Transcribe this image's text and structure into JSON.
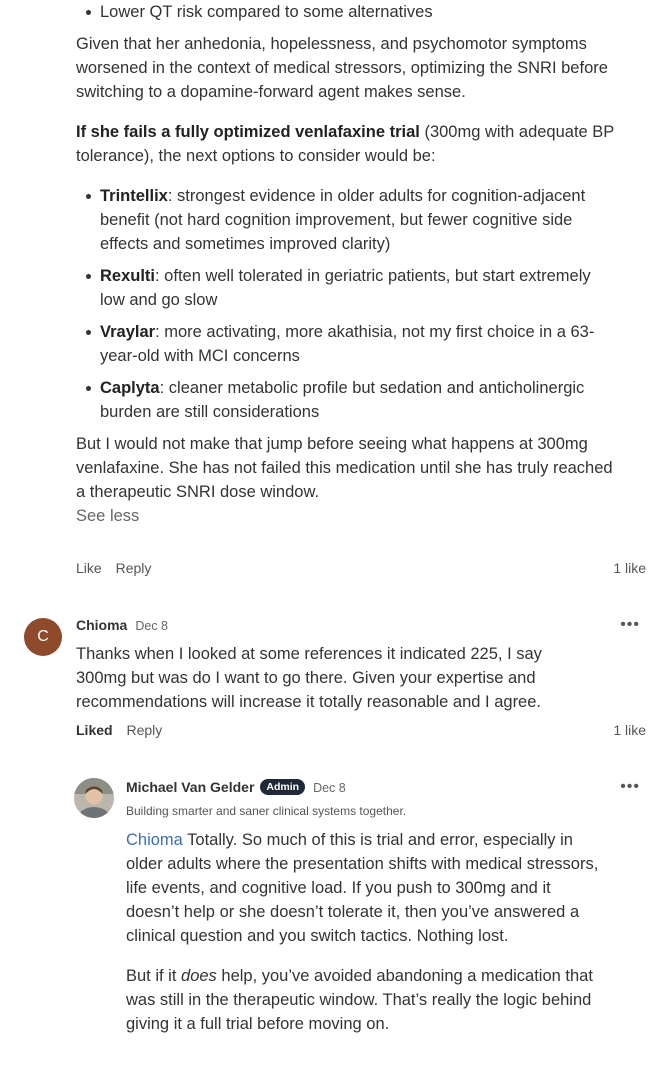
{
  "post": {
    "top_bullet": "Lower QT risk compared to some alternatives",
    "para1": "Given that her anhedonia, hopelessness, and psychomotor symptoms worsened in the context of medical stressors, optimizing the SNRI before switching to a dopamine-forward agent makes sense.",
    "para2_bold": "If she fails a fully optimized venlafaxine trial",
    "para2_rest": " (300mg with adequate BP tolerance), the next options to consider would be:",
    "options": [
      {
        "name": "Trintellix",
        "text": ": strongest evidence in older adults for cognition-adjacent benefit (not hard cognition improvement, but fewer cognitive side effects and sometimes improved clarity)"
      },
      {
        "name": "Rexulti",
        "text": ": often well tolerated in geriatric patients, but start extremely low and go slow"
      },
      {
        "name": "Vraylar",
        "text": ": more activating, more akathisia, not my first choice in a 63-year-old with MCI concerns"
      },
      {
        "name": "Caplyta",
        "text": ": cleaner metabolic profile but sedation and anticholinergic burden are still considerations"
      }
    ],
    "para3": "But I would not make that jump before seeing what happens at 300mg venlafaxine. She has not failed this medication until she has truly reached a therapeutic SNRI dose window.",
    "see_less": "See less",
    "like": "Like",
    "reply": "Reply",
    "likes": "1 like"
  },
  "comment1": {
    "avatar_letter": "C",
    "author": "Chioma",
    "date": "Dec 8",
    "menu": "•••",
    "text": "Thanks when I looked at some references it indicated 225, I say 300mg but was do I want to go there. Given your expertise and recommendations will increase it totally reasonable and I agree.",
    "liked": "Liked",
    "reply": "Reply",
    "likes": "1 like"
  },
  "comment2": {
    "author": "Michael Van Gelder",
    "badge": "Admin",
    "date": "Dec 8",
    "menu": "•••",
    "tagline": "Building smarter and saner clinical systems together.",
    "mention": "Chioma",
    "p1": " Totally. So much of this is trial and error, especially in older adults where the presentation shifts with medical stressors, life events, and cognitive load. If you push to 300mg and it doesn’t help or she doesn’t tolerate it, then you’ve answered a clinical question and you switch tactics. Nothing lost.",
    "p2_a": "But if it ",
    "p2_em": "does",
    "p2_b": " help, you’ve avoided abandoning a medication that was still in the therapeutic window. That’s really the logic behind giving it a full trial before moving on."
  }
}
